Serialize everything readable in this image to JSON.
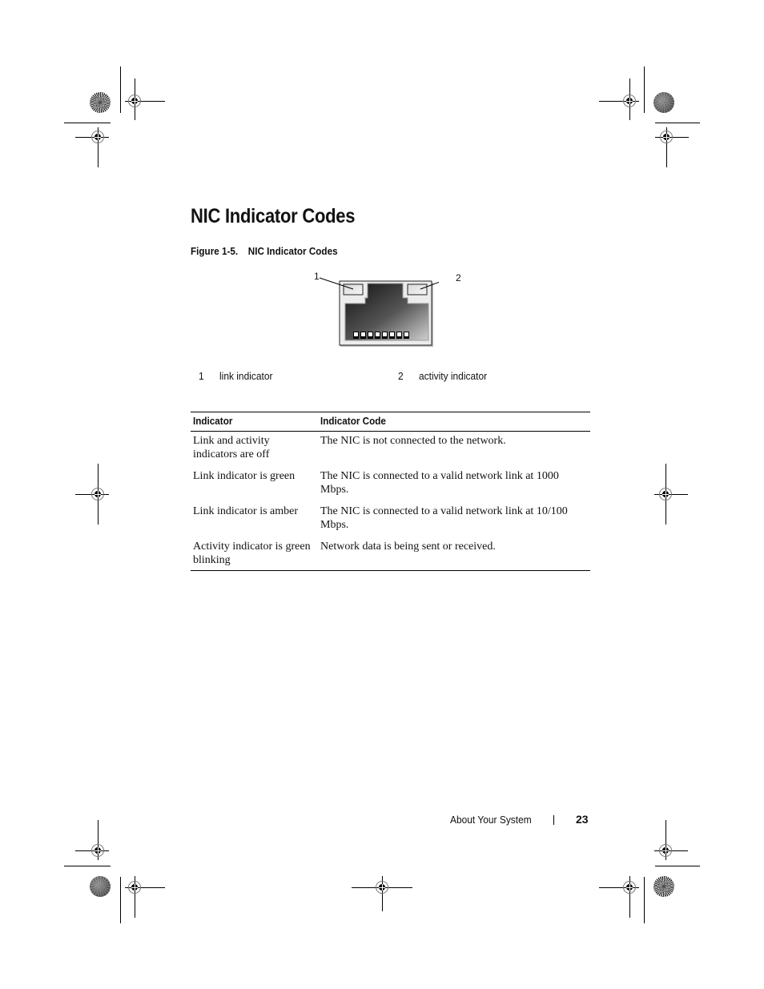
{
  "page": {
    "section_title": "NIC Indicator Codes",
    "figure": {
      "number_label": "Figure 1-5.",
      "title": "NIC Indicator Codes",
      "callouts": [
        {
          "number": "1",
          "label": "link indicator"
        },
        {
          "number": "2",
          "label": "activity indicator"
        }
      ]
    },
    "table": {
      "headers": [
        "Indicator",
        "Indicator Code"
      ],
      "rows": [
        {
          "indicator": "Link and activity indicators are off",
          "code": "The NIC is not connected to the network."
        },
        {
          "indicator": "Link indicator is green",
          "code": "The NIC is connected to a valid network link at 1000 Mbps."
        },
        {
          "indicator": "Link indicator is amber",
          "code": "The NIC is connected to a valid network link at 10/100 Mbps."
        },
        {
          "indicator": "Activity indicator is green blinking",
          "code": "Network data is being sent or received."
        }
      ]
    },
    "footer": {
      "section": "About Your System",
      "page_number": "23"
    }
  }
}
